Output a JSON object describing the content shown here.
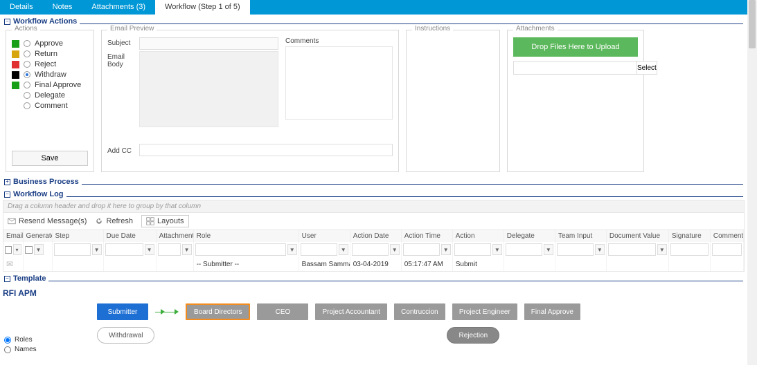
{
  "tabs": {
    "details": "Details",
    "notes": "Notes",
    "attachments": "Attachments (3)",
    "workflow": "Workflow (Step 1 of 5)"
  },
  "sec": {
    "wa": "Workflow Actions",
    "bp": "Business Process",
    "log": "Workflow Log",
    "tmpl": "Template"
  },
  "actionsPanel": {
    "legend": "Actions",
    "items": [
      {
        "label": "Approve",
        "color": "#17a017"
      },
      {
        "label": "Return",
        "color": "#d7a50d"
      },
      {
        "label": "Reject",
        "color": "#e03030"
      },
      {
        "label": "Withdraw",
        "color": "#000000",
        "selected": true
      },
      {
        "label": "Final Approve",
        "color": "#17a017"
      },
      {
        "label": "Delegate",
        "color": ""
      },
      {
        "label": "Comment",
        "color": ""
      }
    ],
    "save": "Save"
  },
  "email": {
    "legend": "Email Preview",
    "subject": "Subject",
    "body": "Email Body",
    "comments": "Comments",
    "addcc": "Add CC"
  },
  "instr": {
    "legend": "Instructions"
  },
  "att": {
    "legend": "Attachments",
    "drop": "Drop Files Here to Upload",
    "select": "Select"
  },
  "log": {
    "hint": "Drag a column header and drop it here to group by that column",
    "resend": "Resend Message(s)",
    "refresh": "Refresh",
    "layouts": "Layouts",
    "cols": {
      "email": "Email",
      "gen": "Generated",
      "step": "Step",
      "due": "Due Date",
      "att": "Attachments",
      "role": "Role",
      "user": "User",
      "adate": "Action Date",
      "atime": "Action Time",
      "action": "Action",
      "del": "Delegate",
      "team": "Team Input",
      "doc": "Document Value",
      "sig": "Signature",
      "com": "Comments"
    },
    "row": {
      "role": "-- Submitter --",
      "user": "Bassam Samman(Ba",
      "adate": "03-04-2019",
      "atime": "05:17:47 AM",
      "action": "Submit"
    }
  },
  "tmpl": {
    "title": "RFI APM",
    "roles": "Roles",
    "names": "Names",
    "nodes": {
      "submitter": "Submitter",
      "board": "Board Directors",
      "ceo": "CEO",
      "pa": "Project Accountant",
      "con": "Contruccion",
      "pe": "Project Engineer",
      "final": "Final Approve",
      "withdraw": "Withdrawal",
      "reject": "Rejection"
    }
  }
}
